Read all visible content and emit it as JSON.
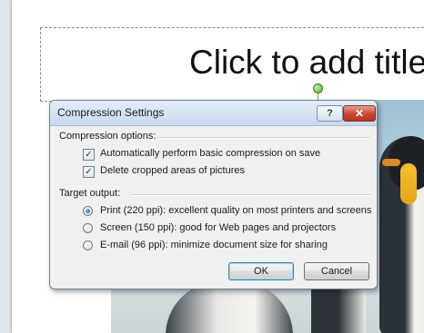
{
  "slide": {
    "title_placeholder": "Click to add title"
  },
  "dialog": {
    "title": "Compression Settings",
    "help_label": "?",
    "close_label": "✕",
    "compression_options_label": "Compression options:",
    "options": [
      {
        "label": "Automatically perform basic compression on save",
        "checked": true
      },
      {
        "label": "Delete cropped areas of pictures",
        "checked": true
      }
    ],
    "target_output_label": "Target output:",
    "targets": [
      {
        "label": "Print (220 ppi): excellent quality on most printers and screens",
        "selected": true
      },
      {
        "label": "Screen (150 ppi): good for Web pages and projectors",
        "selected": false
      },
      {
        "label": "E-mail (96 ppi): minimize document size for sharing",
        "selected": false
      }
    ],
    "ok_label": "OK",
    "cancel_label": "Cancel",
    "check_glyph": "✓"
  }
}
